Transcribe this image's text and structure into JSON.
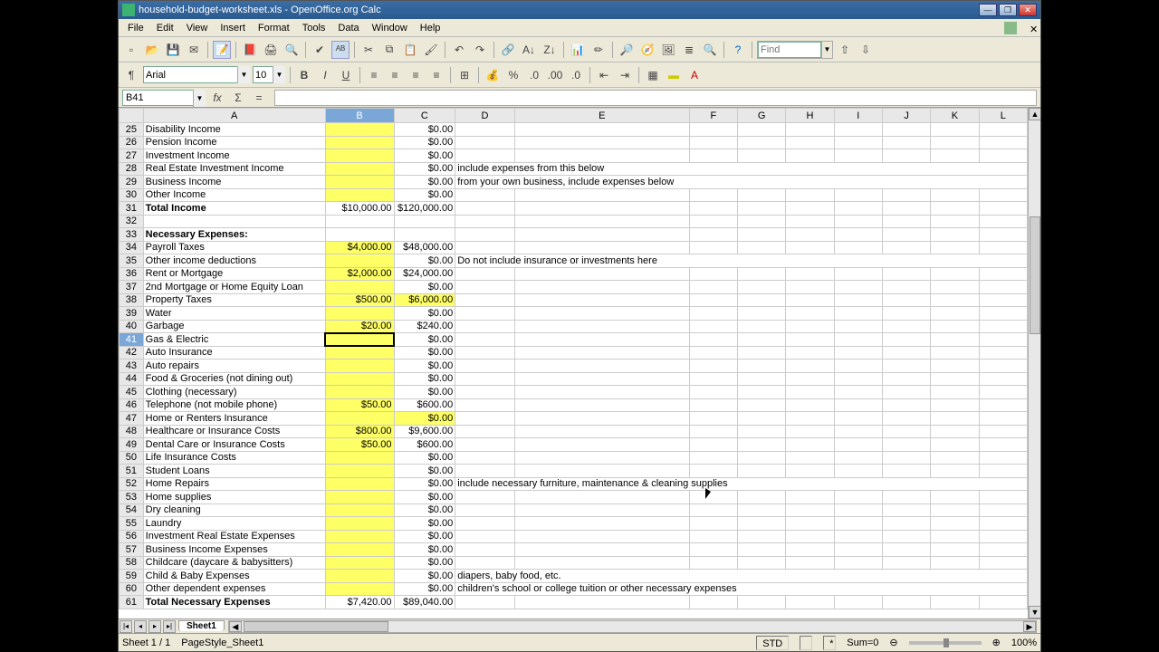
{
  "window": {
    "title": "household-budget-worksheet.xls - OpenOffice.org Calc"
  },
  "menu": [
    "File",
    "Edit",
    "View",
    "Insert",
    "Format",
    "Tools",
    "Data",
    "Window",
    "Help"
  ],
  "find": {
    "placeholder": "Find"
  },
  "format": {
    "font": "Arial",
    "size": "10"
  },
  "namebox": {
    "value": "B41"
  },
  "cols": [
    "A",
    "B",
    "C",
    "D",
    "E",
    "F",
    "G",
    "H",
    "I",
    "J",
    "K",
    "L"
  ],
  "selected": {
    "col": "B",
    "row": 41
  },
  "rows": [
    {
      "n": 25,
      "a": "Disability Income",
      "b": "",
      "c": "$0.00",
      "by": true
    },
    {
      "n": 26,
      "a": "Pension Income",
      "b": "",
      "c": "$0.00",
      "by": true
    },
    {
      "n": 27,
      "a": "Investment Income",
      "b": "",
      "c": "$0.00",
      "by": true
    },
    {
      "n": 28,
      "a": "Real Estate Investment Income",
      "b": "",
      "c": "$0.00",
      "by": true,
      "d": "include expenses from this below"
    },
    {
      "n": 29,
      "a": "Business Income",
      "b": "",
      "c": "$0.00",
      "by": true,
      "d": "from your own business, include expenses below"
    },
    {
      "n": 30,
      "a": "Other Income",
      "b": "",
      "c": "$0.00",
      "by": true
    },
    {
      "n": 31,
      "a": "Total Income",
      "abold": true,
      "b": "$10,000.00",
      "c": "$120,000.00"
    },
    {
      "n": 32,
      "a": ""
    },
    {
      "n": 33,
      "a": "Necessary Expenses:",
      "abold": true
    },
    {
      "n": 34,
      "a": "Payroll Taxes",
      "b": "$4,000.00",
      "c": "$48,000.00",
      "by": true
    },
    {
      "n": 35,
      "a": "Other income deductions",
      "b": "",
      "c": "$0.00",
      "by": true,
      "d": "Do not include insurance or investments here"
    },
    {
      "n": 36,
      "a": "Rent or Mortgage",
      "b": "$2,000.00",
      "c": "$24,000.00",
      "by": true
    },
    {
      "n": 37,
      "a": "2nd Mortgage or Home Equity Loan",
      "b": "",
      "c": "$0.00",
      "by": true
    },
    {
      "n": 38,
      "a": "Property Taxes",
      "b": "$500.00",
      "c": "$6,000.00",
      "by": true,
      "cy": true
    },
    {
      "n": 39,
      "a": "Water",
      "b": "",
      "c": "$0.00",
      "by": true
    },
    {
      "n": 40,
      "a": "Garbage",
      "b": "$20.00",
      "c": "$240.00",
      "by": true
    },
    {
      "n": 41,
      "a": "Gas & Electric",
      "b": "",
      "c": "$0.00",
      "by": true,
      "sel": true
    },
    {
      "n": 42,
      "a": "Auto Insurance",
      "b": "",
      "c": "$0.00",
      "by": true
    },
    {
      "n": 43,
      "a": "Auto repairs",
      "b": "",
      "c": "$0.00",
      "by": true
    },
    {
      "n": 44,
      "a": "Food & Groceries (not dining out)",
      "b": "",
      "c": "$0.00",
      "by": true
    },
    {
      "n": 45,
      "a": "Clothing (necessary)",
      "b": "",
      "c": "$0.00",
      "by": true
    },
    {
      "n": 46,
      "a": "Telephone (not mobile phone)",
      "b": "$50.00",
      "c": "$600.00",
      "by": true
    },
    {
      "n": 47,
      "a": "Home or Renters Insurance",
      "b": "",
      "c": "$0.00",
      "by": true,
      "cy": true
    },
    {
      "n": 48,
      "a": "Healthcare or Insurance Costs",
      "b": "$800.00",
      "c": "$9,600.00",
      "by": true
    },
    {
      "n": 49,
      "a": "Dental Care or Insurance Costs",
      "b": "$50.00",
      "c": "$600.00",
      "by": true
    },
    {
      "n": 50,
      "a": "Life Insurance Costs",
      "b": "",
      "c": "$0.00",
      "by": true
    },
    {
      "n": 51,
      "a": "Student Loans",
      "b": "",
      "c": "$0.00",
      "by": true
    },
    {
      "n": 52,
      "a": "Home Repairs",
      "b": "",
      "c": "$0.00",
      "by": true,
      "d": "include necessary furniture, maintenance & cleaning supplies"
    },
    {
      "n": 53,
      "a": "Home supplies",
      "b": "",
      "c": "$0.00",
      "by": true
    },
    {
      "n": 54,
      "a": "Dry cleaning",
      "b": "",
      "c": "$0.00",
      "by": true
    },
    {
      "n": 55,
      "a": "Laundry",
      "b": "",
      "c": "$0.00",
      "by": true
    },
    {
      "n": 56,
      "a": "Investment Real Estate Expenses",
      "b": "",
      "c": "$0.00",
      "by": true
    },
    {
      "n": 57,
      "a": "Business Income Expenses",
      "b": "",
      "c": "$0.00",
      "by": true
    },
    {
      "n": 58,
      "a": "Childcare (daycare & babysitters)",
      "b": "",
      "c": "$0.00",
      "by": true
    },
    {
      "n": 59,
      "a": "Child & Baby Expenses",
      "b": "",
      "c": "$0.00",
      "by": true,
      "d": "diapers, baby food, etc."
    },
    {
      "n": 60,
      "a": "Other dependent expenses",
      "b": "",
      "c": "$0.00",
      "by": true,
      "d": "children's school or college tuition or other necessary expenses"
    },
    {
      "n": 61,
      "a": "Total Necessary Expenses",
      "abold": true,
      "b": "$7,420.00",
      "c": "$89,040.00"
    }
  ],
  "tabs": {
    "active": "Sheet1"
  },
  "status": {
    "sheet": "Sheet 1 / 1",
    "pagestyle": "PageStyle_Sheet1",
    "mode": "STD",
    "sum": "Sum=0",
    "zoom": "100%"
  }
}
